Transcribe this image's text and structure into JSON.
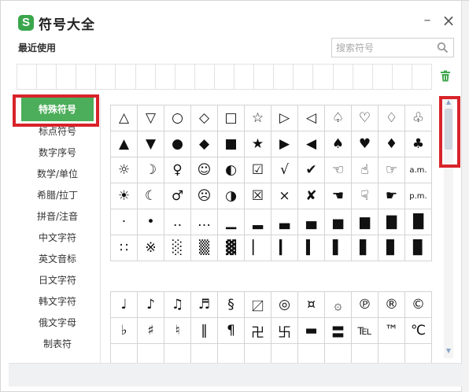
{
  "window": {
    "title": "符号大全",
    "logo_letter": "S"
  },
  "recent": {
    "label": "最近使用",
    "cell_count": 21
  },
  "search": {
    "placeholder": "搜索符号"
  },
  "categories": [
    {
      "label": "特殊符号",
      "active": true
    },
    {
      "label": "标点符号"
    },
    {
      "label": "数字序号"
    },
    {
      "label": "数学/单位"
    },
    {
      "label": "希腊/拉丁"
    },
    {
      "label": "拼音/注音"
    },
    {
      "label": "中文字符"
    },
    {
      "label": "英文音标"
    },
    {
      "label": "日文字符"
    },
    {
      "label": "韩文字符"
    },
    {
      "label": "俄文字母"
    },
    {
      "label": "制表符"
    }
  ],
  "symbols_group1": [
    [
      "△",
      "▽",
      "○",
      "◇",
      "□",
      "☆",
      "▷",
      "◁",
      "♤",
      "♡",
      "♢",
      "♧"
    ],
    [
      "▲",
      "▼",
      "●",
      "◆",
      "■",
      "★",
      "▶",
      "◀",
      "♠",
      "♥",
      "♦",
      "♣"
    ],
    [
      "☼",
      "☽",
      "♀",
      "☺",
      "◐",
      "☑",
      "√",
      "✔",
      "☜",
      "☝",
      "☞",
      "a.m."
    ],
    [
      "☀",
      "☾",
      "♂",
      "☹",
      "◑",
      "☒",
      "×",
      "✘",
      "☚",
      "☟",
      "☛",
      "p.m."
    ],
    [
      "·",
      "•",
      "‥",
      "…",
      "▁",
      "▂",
      "▃",
      "▄",
      "▅",
      "▆",
      "▇",
      "█"
    ],
    [
      "∷",
      "※",
      "░",
      "▒",
      "▓",
      "▏",
      "▎",
      "▍",
      "▌",
      "▋",
      "▊",
      "▉"
    ]
  ],
  "symbols_group2": [
    [
      "♩",
      "♪",
      "♫",
      "♬",
      "§",
      "〼",
      "◎",
      "¤",
      "۞",
      "℗",
      "®",
      "©"
    ],
    [
      "♭",
      "♯",
      "♮",
      "‖",
      "¶",
      "卍",
      "卐",
      "▬",
      "〓",
      "℡",
      "™",
      "℃"
    ],
    [
      "",
      "",
      "",
      "",
      "",
      "",
      "",
      "",
      "",
      "",
      "",
      ""
    ]
  ],
  "colors": {
    "accent": "#4cae5a",
    "highlight": "#d8232a"
  }
}
